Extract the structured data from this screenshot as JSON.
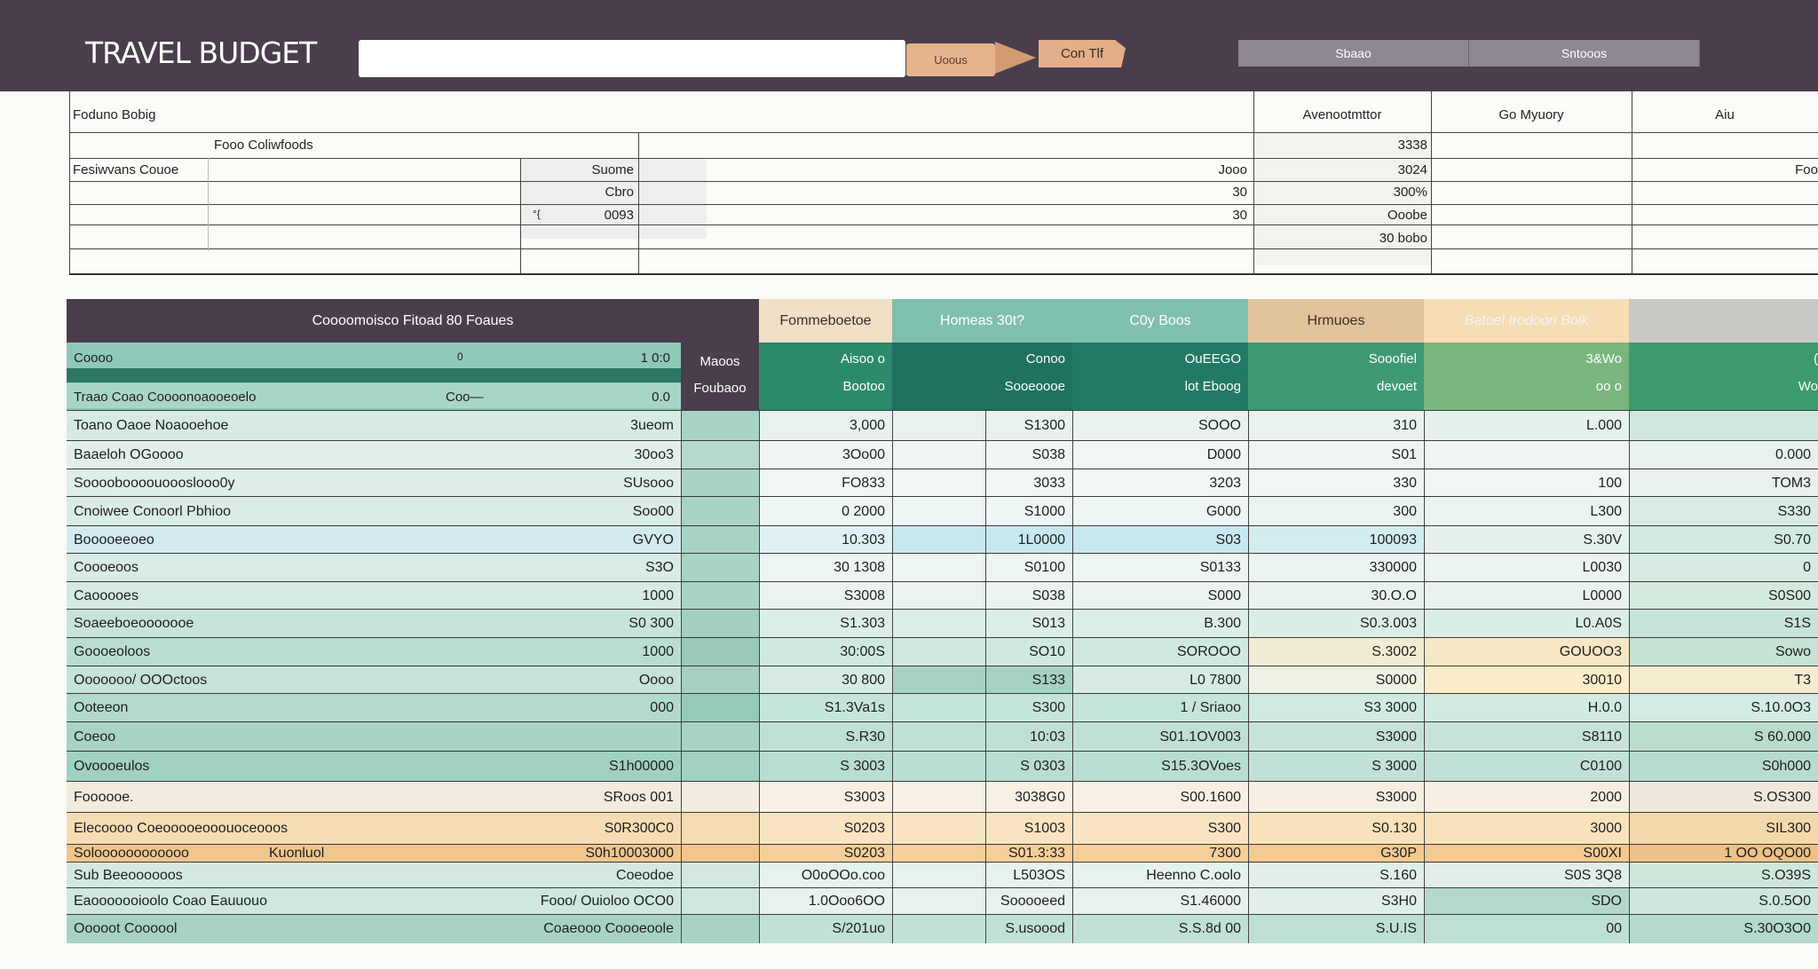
{
  "app": {
    "title": "TRAVEL BUDGET"
  },
  "toolbar": {
    "search_value": "",
    "button_a": "Uoous",
    "button_b": "Con Tlf",
    "tabs": [
      "Sbaao",
      "Sntooos"
    ]
  },
  "summary": {
    "header": {
      "left": "Foduno Bobig",
      "c1": "Avenootmttor",
      "c2": "Go Myuory",
      "c3": "Aiu"
    },
    "subheader": "Fooo Coliwfoods",
    "label": "Fesiwvans Couoe",
    "col_b": [
      "",
      "Suome",
      "Cbro",
      "0093"
    ],
    "col_b_prefix": "°{",
    "col_c": [
      "",
      "Jooo",
      "30",
      "30"
    ],
    "col_d": [
      "3338",
      "3024",
      "300%",
      "Ooobe",
      "30 bobo"
    ],
    "col_f": [
      "",
      "Foo",
      "",
      ""
    ]
  },
  "table": {
    "title": "Coooomoisco Fitoad 80 Foaues",
    "columns": [
      "Fommeboetoe",
      "Homeas 30t?",
      "C0y Boos",
      "Hrmuoes",
      "Batoel trodoon Bolk",
      ""
    ],
    "sub_labels_1": [
      "Coooo",
      "Traao Coao Coooonoaooeoelo"
    ],
    "sub_vals_1": [
      "1 0:0",
      "0.0"
    ],
    "sub_mid_1": [
      "0",
      "Coo—"
    ],
    "sub_col_a": [
      "Maoos",
      "Foubaoo"
    ],
    "sub_col_b": [
      "Aisoo o",
      "Bootoo"
    ],
    "sub_col_c": [
      "Conoo",
      "Sooeoooe"
    ],
    "sub_col_d": [
      "OuEEGO",
      "lot Eboog"
    ],
    "sub_col_e": [
      "Sooofiel",
      "devoet"
    ],
    "sub_col_f": [
      "3&Wo",
      "oo o"
    ],
    "sub_col_g": [
      "(",
      "Wo"
    ],
    "rows": [
      {
        "label": "Toano Oaoe Noaooehoe",
        "b": "3ueom",
        "d": "3,000",
        "e": "S1300",
        "f": "SOOO",
        "g": "310",
        "h": "L.000",
        "i": ""
      },
      {
        "label": "Baaeloh OGoooo",
        "b": "30oo3",
        "d": "3Oo00",
        "e": "S038",
        "f": "D000",
        "g": "S01",
        "h": "",
        "i": "0.000"
      },
      {
        "label": "Sooooboooouoooslooo0y",
        "b": "SUsooo",
        "d": "FO833",
        "e": "3033",
        "f": "3203",
        "g": "330",
        "h": "100",
        "i": "TOM3"
      },
      {
        "label": "Cnoiwee Conoorl Pbhioo",
        "b": "Soo00",
        "d": "0 2000",
        "e": "S1000",
        "f": "G000",
        "g": "300",
        "h": "L300",
        "i": "S330"
      },
      {
        "label": "Booooeeoeo",
        "b": "GVYO",
        "d": "10.303",
        "e": "1L0000",
        "f": "S03",
        "g": "100093",
        "h": "S.30V",
        "i": "S0.70"
      },
      {
        "label": "Coooeoos",
        "b": "S3O",
        "d": "30 1308",
        "e": "S0100",
        "f": "S0133",
        "g": "330000",
        "h": "L0030",
        "i": "0"
      },
      {
        "label": "Caooooes",
        "b": "1000",
        "d": "S3008",
        "e": "S038",
        "f": "S000",
        "g": "30.O.O",
        "h": "L0000",
        "i": "S0S00"
      },
      {
        "label": "Soaeeboeooooooe",
        "b": "S0 300",
        "d": "S1.303",
        "e": "S013",
        "f": "B.300",
        "g": "S0.3.003",
        "h": "L0.A0S",
        "i": "S1S"
      },
      {
        "label": "Goooeoloos",
        "b": "1000",
        "d": "30:00S",
        "e": "SO10",
        "f": "SOROOO",
        "g": "S.3002",
        "h": "GOUOO3",
        "i": "Sowo"
      },
      {
        "label": "Ooooooo/ OOOctoos",
        "b": "Oooo",
        "d": "30 800",
        "e": "S133",
        "f": "L0 7800",
        "g": "S0000",
        "h": "30010",
        "i": "T3"
      },
      {
        "label": "Ooteeon",
        "b": "000",
        "d": "S1.3Va1s",
        "e": "S300",
        "f": "1 / Sriaoo",
        "g": "S3 3000",
        "h": "H.0.0",
        "i": "S.10.0O3"
      },
      {
        "label": "Coeoo",
        "b": "",
        "d": "S.R30",
        "e": "10:03",
        "f": "S01.1OV003",
        "g": "S3000",
        "h": "S8110",
        "i": "S 60.000"
      },
      {
        "label": "Ovoooeulos",
        "b": "S1h00000",
        "d": "S 3003",
        "e": "S 0303",
        "f": "S15.3OVoes",
        "g": "S 3000",
        "h": "C0100",
        "i": "S0h000"
      },
      {
        "label": "Foooooe.",
        "b": "SRoos 001",
        "d": "S3003",
        "e": "3038G0",
        "f": "S00.1600",
        "g": "S3000",
        "h": "2000",
        "i": "S.OS300"
      },
      {
        "label": "Elecoooo Coeooooeooouoceooos",
        "b": "S0R300C0",
        "d": "S0203",
        "e": "S1003",
        "f": "S300",
        "g": "S0.130",
        "h": "3000",
        "i": "SIL300"
      },
      {
        "label": "Soloooooooooooo",
        "label2": "Kuonluol",
        "b": "S0h10003000",
        "d": "S0203",
        "e": "S01.3:33",
        "f": "7300",
        "g": "G30P",
        "h": "S00XI",
        "i": "1 OO OQO00"
      },
      {
        "label": "Sub Beeoooooos",
        "b": "Coeodoe",
        "d": "O0oOOo.coo",
        "e": "L503OS",
        "f": "Heenno C.oolo",
        "g": "S.160",
        "h": "S0S 3Q8",
        "i": "S.O39S"
      },
      {
        "label": "Eaooooooioolo Coao Eauuouo",
        "b": "Fooo/ Ouioloo OCO0",
        "d": "1.0Ooo6OO",
        "e": "Sooooeed",
        "f": "S1.46000",
        "g": "S3H0",
        "h": "SDO",
        "i": "S.0.5O0"
      },
      {
        "label": "Ooooot Coooool",
        "b": "Coaeooo Coooeoole",
        "d": "S/201uo",
        "e": "S.usoood",
        "f": "S.S.8d 00",
        "g": "S.U.IS",
        "h": "00",
        "i": "S.30O3O0"
      }
    ]
  }
}
